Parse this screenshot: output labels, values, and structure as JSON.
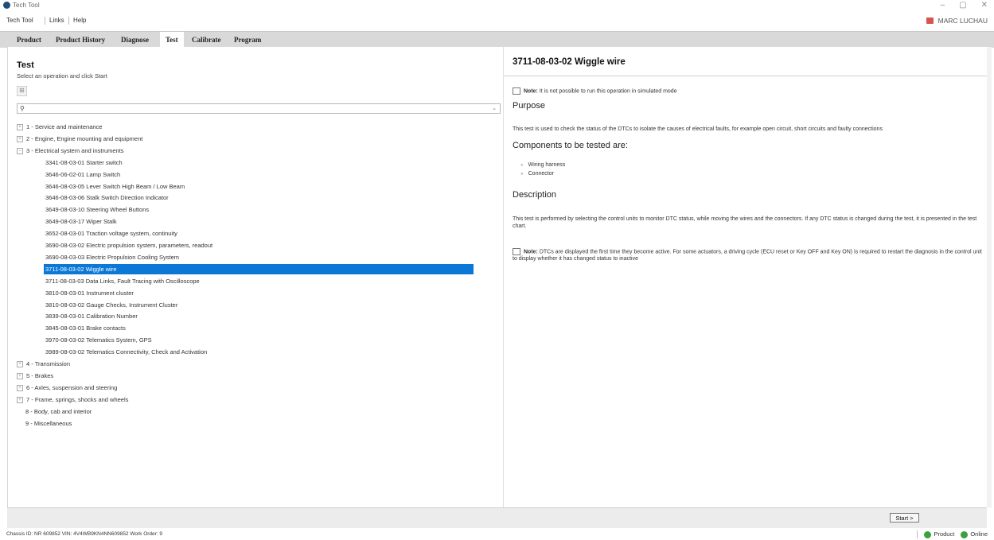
{
  "window": {
    "title": "Tech Tool",
    "controls": [
      "–",
      "▢",
      "✕"
    ]
  },
  "menu": {
    "items": [
      "Tech Tool",
      "Links",
      "Help"
    ],
    "user": "MARC LUCHAU"
  },
  "tabs": [
    "Product",
    "Product History",
    "Diagnose",
    "Test",
    "Calibrate",
    "Program"
  ],
  "active_tab": "Test",
  "left": {
    "title": "Test",
    "subtitle": "Select an operation and click Start",
    "search": {
      "value": "",
      "placeholder": ""
    },
    "tree": [
      {
        "label": "1 - Service and maintenance",
        "level": 0,
        "expander": "+"
      },
      {
        "label": "2 - Engine, Engine mounting and equipment",
        "level": 0,
        "expander": "+"
      },
      {
        "label": "3 - Electrical system and instruments",
        "level": 0,
        "expander": "−"
      },
      {
        "label": "3341-08-03-01 Starter switch",
        "level": 1
      },
      {
        "label": "3646-06-02-01 Lamp Switch",
        "level": 1
      },
      {
        "label": "3646-08-03-05 Lever Switch High Beam / Low Beam",
        "level": 1
      },
      {
        "label": "3646-08-03-06 Stalk Switch Direction Indicator",
        "level": 1
      },
      {
        "label": "3649-08-03-10 Steering Wheel Buttons",
        "level": 1
      },
      {
        "label": "3649-08-03-17 Wiper Stalk",
        "level": 1
      },
      {
        "label": "3652-08-03-01 Traction voltage system, continuity",
        "level": 1
      },
      {
        "label": "3690-08-03-02 Electric propulsion system, parameters, readout",
        "level": 1
      },
      {
        "label": "3690-08-03-03 Electric Propulsion Cooling System",
        "level": 1
      },
      {
        "label": "3711-08-03-02 Wiggle wire",
        "level": 1,
        "selected": true
      },
      {
        "label": "3711-08-03-03 Data Links, Fault Tracing with Oscilloscope",
        "level": 1
      },
      {
        "label": "3810-08-03-01 Instrument cluster",
        "level": 1
      },
      {
        "label": "3810-08-03-02 Gauge Checks, Instrument Cluster",
        "level": 1
      },
      {
        "label": "3839-08-03-01 Calibration Number",
        "level": 1
      },
      {
        "label": "3845-08-03-01 Brake contacts",
        "level": 1
      },
      {
        "label": "3970-08-03-02 Telematics System, GPS",
        "level": 1
      },
      {
        "label": "3989-08-03-02 Telematics Connectivity, Check and Activation",
        "level": 1
      },
      {
        "label": "4 - Transmission",
        "level": 0,
        "expander": "+"
      },
      {
        "label": "5 - Brakes",
        "level": 0,
        "expander": "+"
      },
      {
        "label": "6 - Axles, suspension and steering",
        "level": 0,
        "expander": "+"
      },
      {
        "label": "7 - Frame, springs, shocks and wheels",
        "level": 0,
        "expander": "+"
      },
      {
        "label": "8 - Body, cab and interior",
        "level": 0
      },
      {
        "label": "9 - Miscellaneous",
        "level": 0
      }
    ]
  },
  "right": {
    "title": "3711-08-03-02 Wiggle wire",
    "note1_label": "Note:",
    "note1_text": " It is not possible to run this operation in simulated mode",
    "purpose_heading": "Purpose",
    "purpose_text": "This test is used to check the status of the DTCs to isolate the causes of electrical faults, for example open circuit, short circuits and faulty connections",
    "components_heading": "Components to be tested are:",
    "components": [
      "Wiring harness",
      "Connector"
    ],
    "description_heading": "Description",
    "description_text": "This test is performed by selecting the control units to monitor DTC status, while moving the wires and the connectors. If any DTC status is changed during the test, it is presented in the test chart.",
    "note2_label": "Note:",
    "note2_text": " DTCs are displayed the first time they become active. For some actuators, a driving cycle (ECU reset or Key OFF and Key ON) is required to restart the diagnosis in the control unit to display whether it has changed status to inactive"
  },
  "start_button": "Start >",
  "status": {
    "left": "Chassis ID: NR 609852   VIN: 4V4WB9KN4NN609852   Work Order: 9",
    "product": "Product",
    "online": "Online"
  }
}
